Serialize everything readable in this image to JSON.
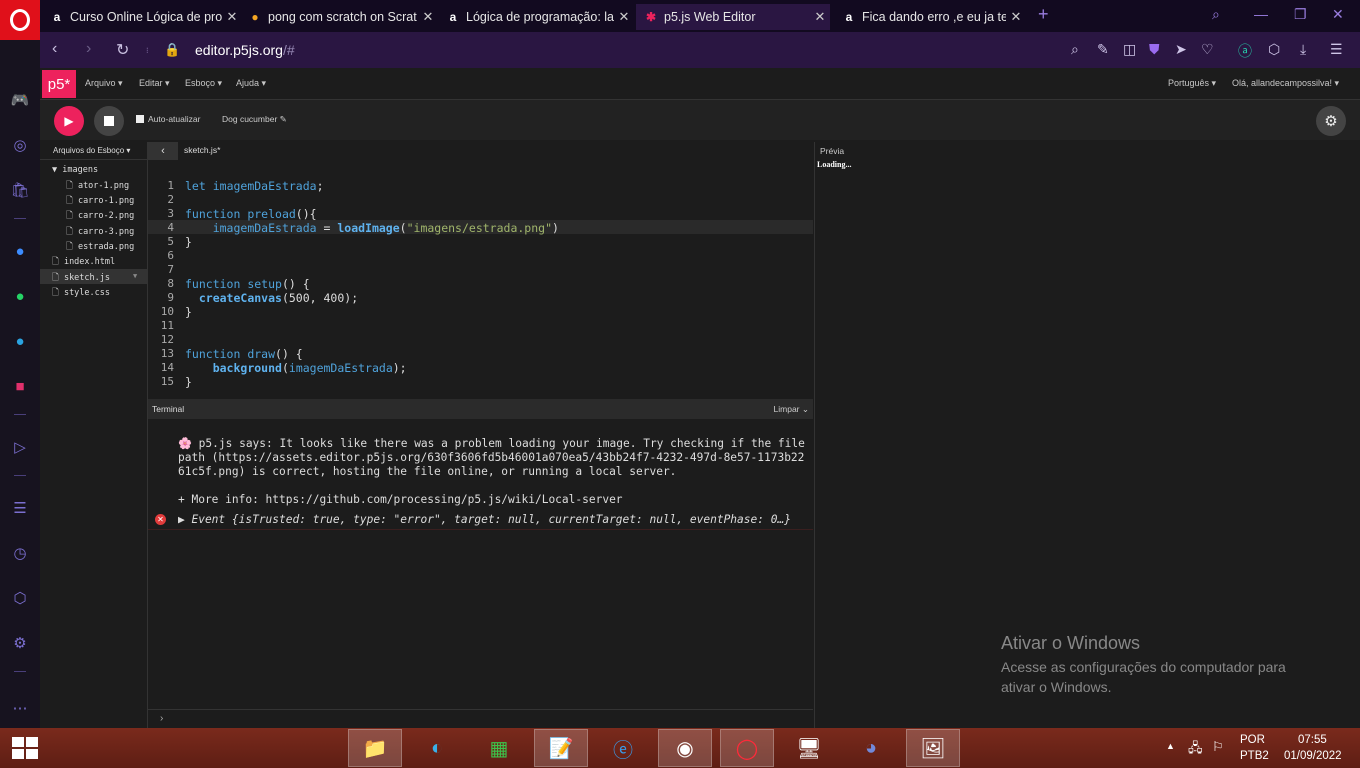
{
  "browser": {
    "tabs": [
      {
        "title": "Curso Online Lógica de pro",
        "icon": "alura-icon",
        "active": false
      },
      {
        "title": "pong com scratch on Scrat",
        "icon": "scratch-icon",
        "active": false
      },
      {
        "title": "Lógica de programação: laç",
        "icon": "alura-icon",
        "active": false
      },
      {
        "title": "p5.js Web Editor",
        "icon": "p5-icon",
        "active": true
      },
      {
        "title": "Fica dando erro ,e eu ja ten",
        "icon": "alura-icon",
        "active": false
      }
    ],
    "url_domain": "editor.p5js.org",
    "url_path": "/#"
  },
  "p5": {
    "logo": "p5*",
    "menus": [
      "Arquivo ▾",
      "Editar ▾",
      "Esboço ▾",
      "Ajuda ▾"
    ],
    "language": "Português ▾",
    "user": "Olá, allandecampossilva! ▾",
    "auto_refresh_label": "Auto-atualizar",
    "sketch_name": "Dog cucumber ✎",
    "files_header": "Arquivos do Esboço ▾",
    "files": [
      {
        "name": "▼ imagens",
        "indent": 0
      },
      {
        "name": "🗋 ator-1.png",
        "indent": 1
      },
      {
        "name": "🗋 carro-1.png",
        "indent": 1
      },
      {
        "name": "🗋 carro-2.png",
        "indent": 1
      },
      {
        "name": "🗋 carro-3.png",
        "indent": 1
      },
      {
        "name": "🗋 estrada.png",
        "indent": 1
      },
      {
        "name": "🗋 index.html",
        "indent": 0
      },
      {
        "name": "🗋 sketch.js",
        "indent": 0
      },
      {
        "name": "🗋 style.css",
        "indent": 0
      }
    ],
    "editor_tab": "sketch.js*",
    "preview_label": "Prévia",
    "preview_status": "Loading...",
    "terminal_title": "Terminal",
    "terminal_clear": "Limpar ⌄",
    "terminal_messages": [
      "🌸 p5.js says: It looks like there was a problem loading your image. Try checking if the file",
      "path (https://assets.editor.p5js.org/630f3606fd5b46001a070ea5/43bb24f7-4232-497d-8e57-1173b22",
      "61c5f.png) is correct, hosting the file online, or running a local server.",
      "",
      "+ More info: https://github.com/processing/p5.js/wiki/Local-server"
    ],
    "error_line": "▶ Event {isTrusted: true, type: \"error\", target: null, currentTarget: null, eventPhase: 0…}",
    "terminal_prompt": "›"
  },
  "code_lines": [
    "let imagemDaEstrada;",
    "",
    "function preload(){",
    "    imagemDaEstrada = loadImage(\"imagens/estrada.png\")",
    "}",
    "",
    "",
    "function setup() {",
    "  createCanvas(500, 400);",
    "}",
    "",
    "",
    "function draw() {",
    "    background(imagemDaEstrada);",
    "}"
  ],
  "windows": {
    "activate_title": "Ativar o Windows",
    "activate_sub": "Acesse as configurações do computador para ativar o Windows.",
    "lang": "POR",
    "layout": "PTB2",
    "time": "07:55",
    "date": "01/09/2022"
  },
  "colors": {
    "accent": "#ed225d",
    "browser_bg": "#2a1642"
  }
}
